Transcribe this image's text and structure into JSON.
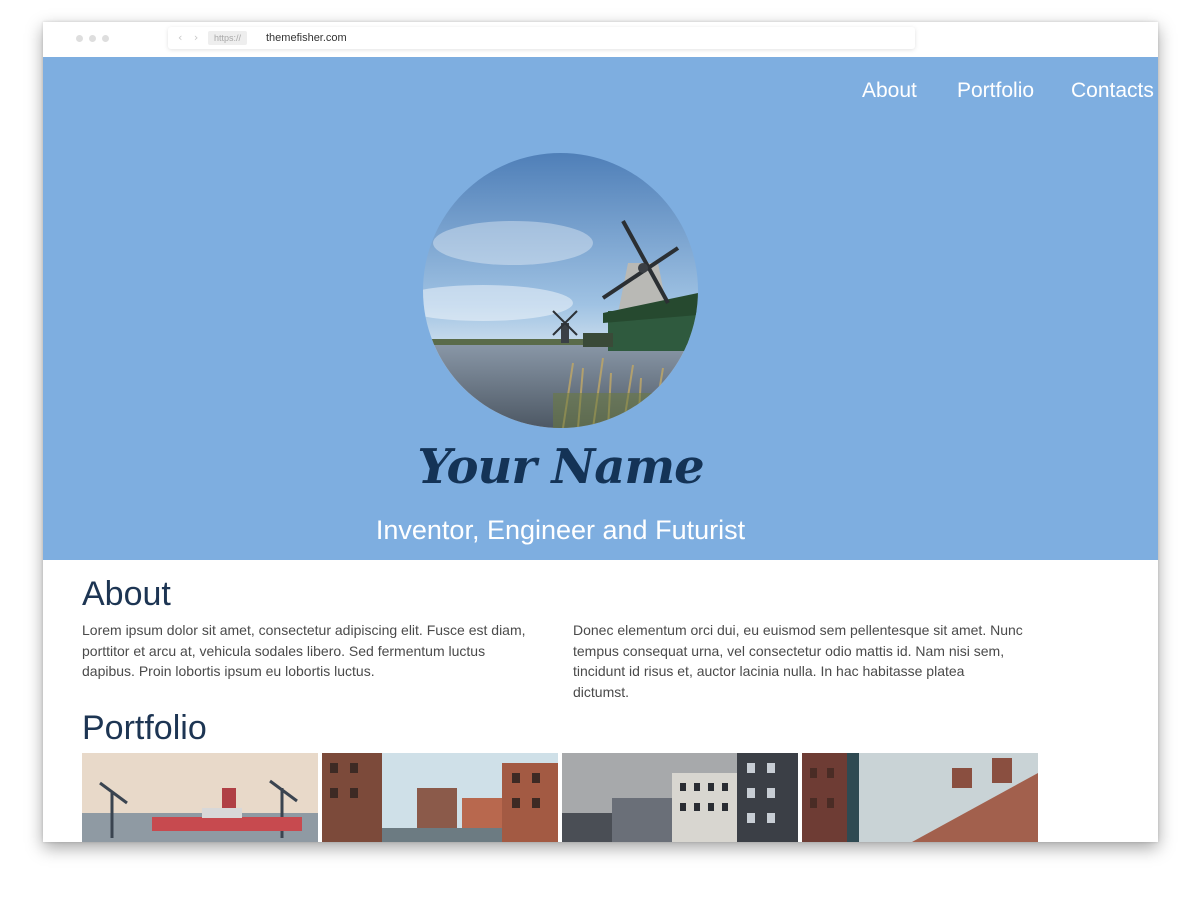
{
  "browser": {
    "protocol": "https://",
    "url": "themefisher.com"
  },
  "nav": {
    "items": [
      "About",
      "Portfolio",
      "Contacts"
    ]
  },
  "hero": {
    "name": "Your Name",
    "subtitle": "Inventor, Engineer and Futurist",
    "avatar_icon": "windmill-photo"
  },
  "about": {
    "title": "About",
    "col1": "Lorem ipsum dolor sit amet, consectetur adipiscing elit. Fusce est diam, porttitor et arcu at, vehicula sodales libero. Sed fermentum luctus dapibus. Proin lobortis ipsum eu lobortis luctus.",
    "col2": "Donec elementum orci dui, eu euismod sem pellentesque sit amet. Nunc tempus consequat urna, vel consectetur odio mattis id. Nam nisi sem, tincidunt id risus et, auctor lacinia nulla. In hac habitasse platea dictumst."
  },
  "portfolio": {
    "title": "Portfolio",
    "thumbs": [
      "harbor-cranes-photo",
      "canal-warehouses-photo",
      "city-buildings-photo",
      "brick-warehouses-photo"
    ]
  },
  "colors": {
    "hero_bg": "#7eaee0",
    "name_color": "#143356",
    "heading_color": "#1d3553",
    "text_color": "#4a4a4a"
  }
}
